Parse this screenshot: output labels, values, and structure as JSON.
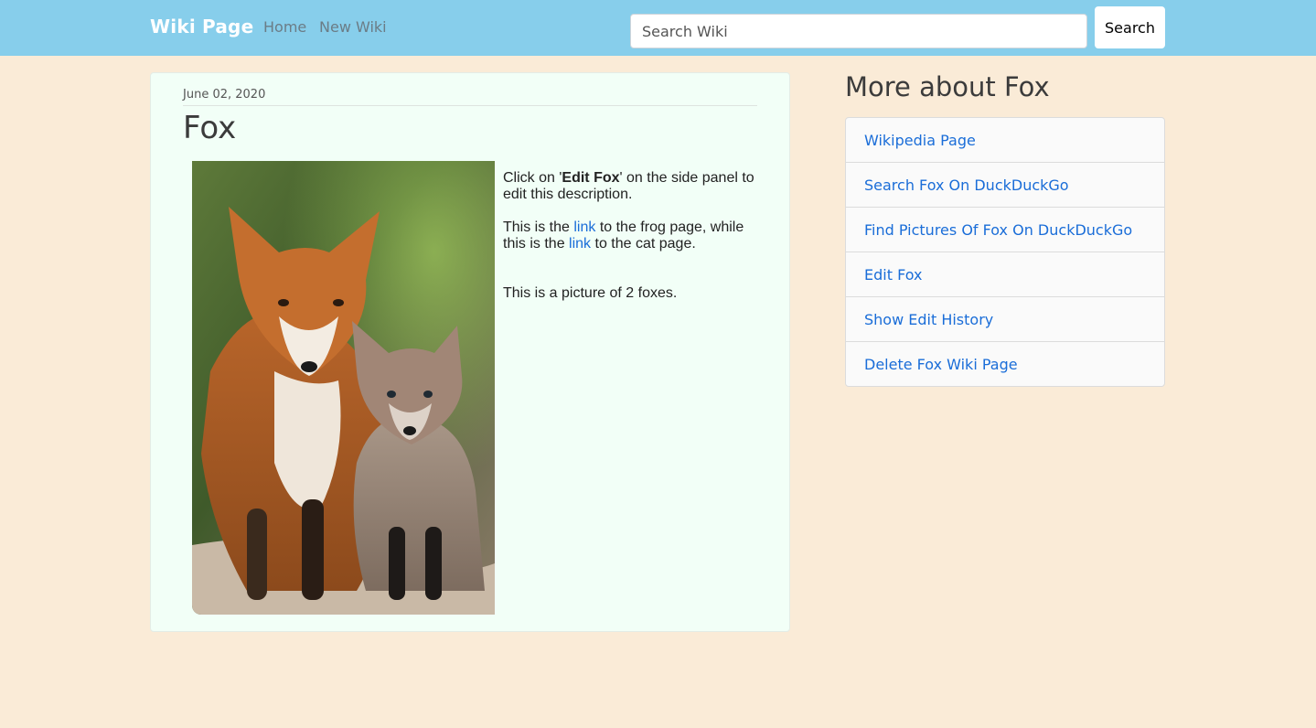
{
  "navbar": {
    "brand": "Wiki Page",
    "links": [
      {
        "label": "Home"
      },
      {
        "label": "New Wiki"
      }
    ],
    "search": {
      "placeholder": "Search Wiki",
      "value": "",
      "button_label": "Search"
    }
  },
  "article": {
    "date": "June 02, 2020",
    "title": "Fox",
    "image_alt": "Adult fox and fox kit",
    "paragraph1": {
      "before": "Click on '",
      "bold": "Edit Fox",
      "after": "' on the side panel to edit this description."
    },
    "paragraph2": {
      "part1": "This is the ",
      "link1": "link",
      "part2": " to the frog page, while this is the ",
      "link2": "link",
      "part3": " to the cat page."
    },
    "paragraph3": "This is a picture of 2 foxes."
  },
  "sidebar": {
    "title": "More about Fox",
    "items": [
      {
        "label": "Wikipedia Page"
      },
      {
        "label": "Search Fox On DuckDuckGo"
      },
      {
        "label": "Find Pictures Of Fox On DuckDuckGo"
      },
      {
        "label": "Edit Fox"
      },
      {
        "label": "Show Edit History"
      },
      {
        "label": "Delete Fox Wiki Page"
      }
    ]
  },
  "colors": {
    "navbar_bg": "#87ceeb",
    "page_bg": "#faebd7",
    "card_bg": "#f2fff7",
    "link": "#1a6dd8"
  }
}
